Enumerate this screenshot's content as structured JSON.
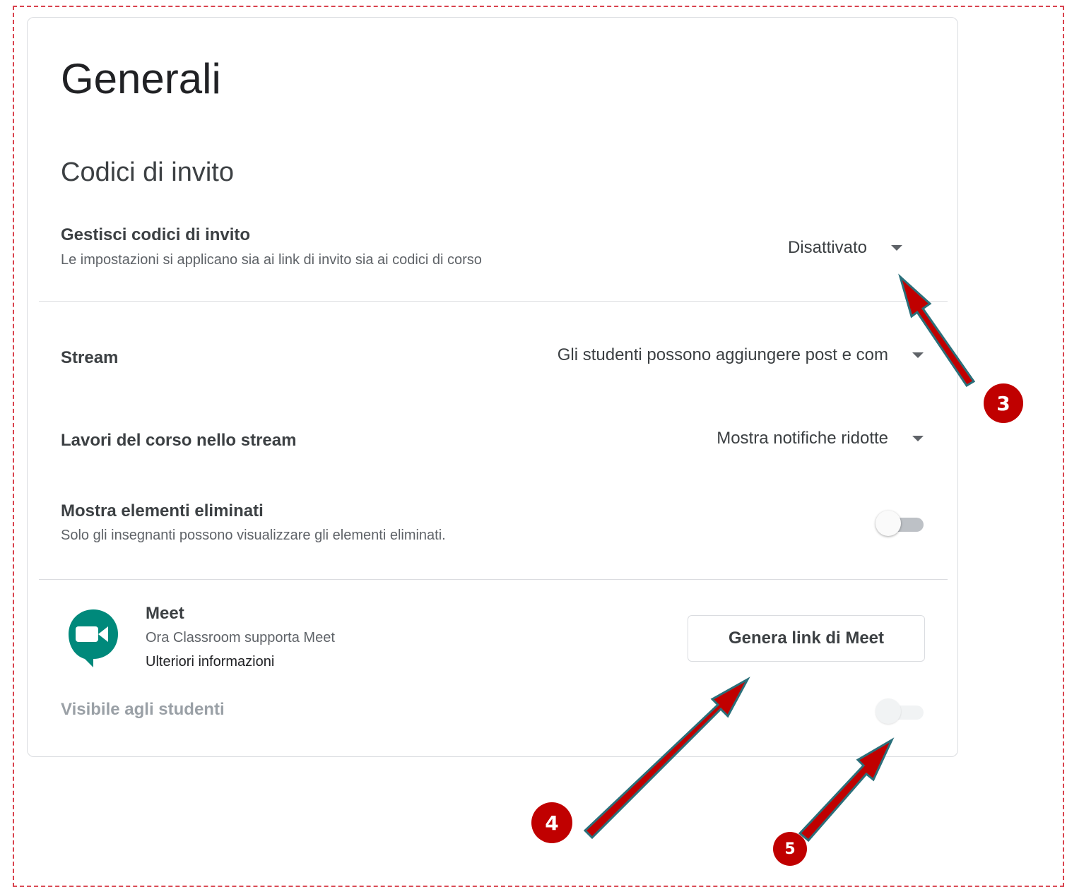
{
  "page": {
    "title": "Generali",
    "invite_section_title": "Codici di invito"
  },
  "invite_codes": {
    "label": "Gestisci codici di invito",
    "description": "Le impostazioni si applicano sia ai link di invito sia ai codici di corso",
    "value": "Disattivato"
  },
  "stream": {
    "label": "Stream",
    "value": "Gli studenti possono aggiungere post e com"
  },
  "classwork_stream": {
    "label": "Lavori del corso nello stream",
    "value": "Mostra notifiche ridotte"
  },
  "deleted_items": {
    "label": "Mostra elementi eliminati",
    "description": "Solo gli insegnanti possono visualizzare gli elementi eliminati.",
    "enabled": false
  },
  "meet": {
    "title": "Meet",
    "subtitle": "Ora Classroom supporta Meet",
    "learn_more": "Ulteriori informazioni",
    "button_label": "Genera link di Meet",
    "visible_label": "Visibile agli studenti",
    "visible_enabled": false,
    "icon": "google-meet-icon",
    "icon_color": "#00897b"
  },
  "annotations": {
    "color": "#c00000",
    "badges": [
      "3",
      "4",
      "5"
    ]
  }
}
